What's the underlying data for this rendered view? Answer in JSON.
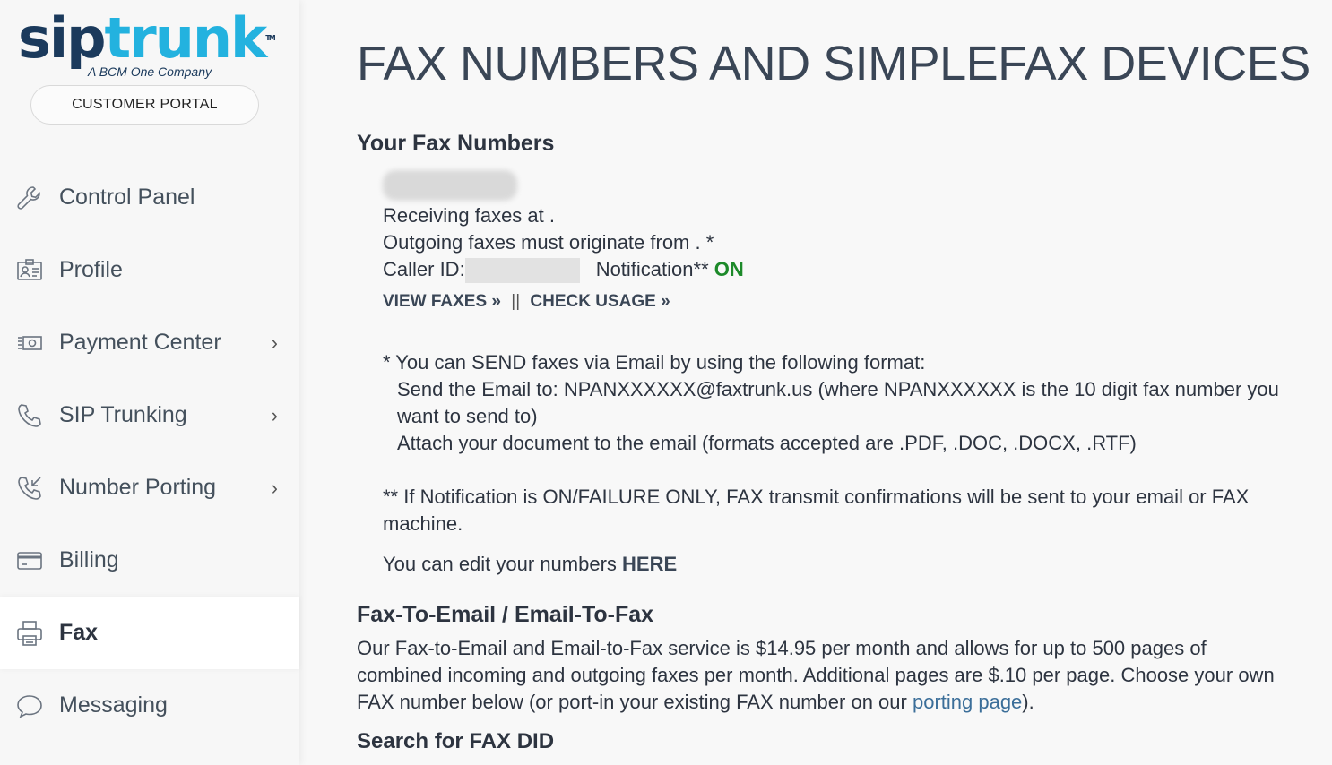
{
  "brand": {
    "logo_sip": "sip",
    "logo_trunk": "trunk",
    "logo_tm": "TM",
    "tagline": "A BCM One Company",
    "portal_label": "CUSTOMER PORTAL"
  },
  "sidebar": {
    "items": [
      {
        "label": "Control Panel",
        "icon": "wrench-icon",
        "chevron": false
      },
      {
        "label": "Profile",
        "icon": "id-card-icon",
        "chevron": false
      },
      {
        "label": "Payment Center",
        "icon": "cash-icon",
        "chevron": true
      },
      {
        "label": "SIP Trunking",
        "icon": "phone-icon",
        "chevron": true
      },
      {
        "label": "Number Porting",
        "icon": "phone-incoming-icon",
        "chevron": true
      },
      {
        "label": "Billing",
        "icon": "credit-card-icon",
        "chevron": false
      },
      {
        "label": "Fax",
        "icon": "printer-icon",
        "chevron": false,
        "active": true
      },
      {
        "label": "Messaging",
        "icon": "chat-bubble-icon",
        "chevron": false
      }
    ],
    "chevron_glyph": "›"
  },
  "main": {
    "title": "FAX NUMBERS AND SIMPLEFAX DEVICES",
    "your_fax_heading": "Your Fax Numbers",
    "receiving": "Receiving faxes at .",
    "outgoing": "Outgoing faxes must originate from . *",
    "caller_id_label": "Caller ID:",
    "notification_label": "Notification**",
    "notification_value": "ON",
    "view_faxes": "VIEW FAXES »",
    "separator": "||",
    "check_usage": "CHECK USAGE »",
    "send_note_1": "* You can SEND faxes via Email by using the following format:",
    "send_note_2": "Send the Email to: NPANXXXXXX@faxtrunk.us (where NPANXXXXXX is the 10 digit fax number you",
    "send_note_3": "want to send to)",
    "send_note_4": "Attach your document to the email (formats accepted are .PDF, .DOC, .DOCX, .RTF)",
    "notif_note_1": "** If Notification is ON/FAILURE ONLY, FAX transmit confirmations will be sent to your email or FAX",
    "notif_note_2": "machine.",
    "edit_prefix": "You can edit your numbers",
    "edit_link": "HERE",
    "fax_email_heading": "Fax-To-Email / Email-To-Fax",
    "desc_1": "Our Fax-to-Email and Email-to-Fax service is $14.95 per month and allows for up to 500 pages of",
    "desc_2": "combined incoming and outgoing faxes per month. Additional pages are $.10 per page. Choose your own",
    "desc_3_prefix": "FAX number below (or port-in your existing FAX number on our",
    "desc_3_link": "porting page",
    "desc_3_suffix": ").",
    "search_heading": "Search for FAX DID"
  },
  "colors": {
    "brand_dark": "#1b3a5c",
    "brand_light": "#23b2df",
    "notification_on": "#1d8a2a",
    "link": "#3b6e99"
  }
}
